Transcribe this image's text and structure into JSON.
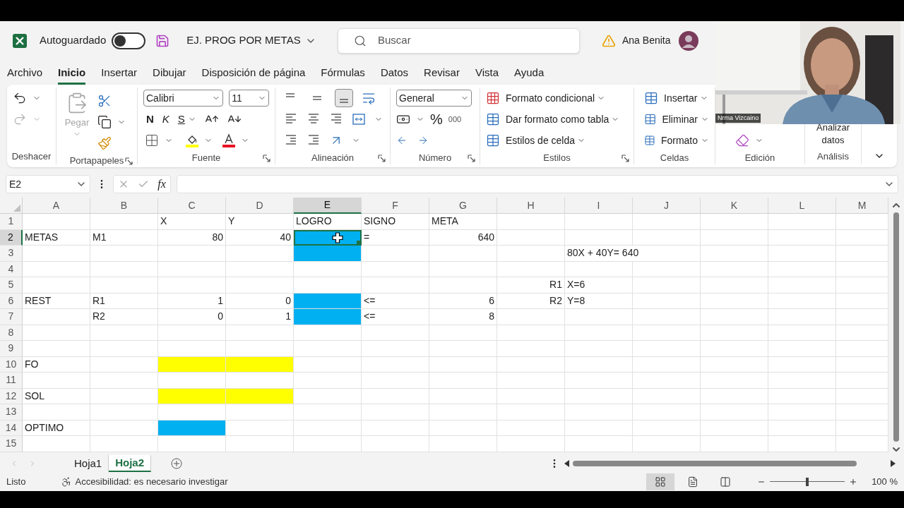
{
  "title_bar": {
    "autosave_label": "Autoguardado",
    "autosave_on": false,
    "document_title": "EJ. PROG POR METAS",
    "search_placeholder": "Buscar",
    "user_name": "Ana Benita"
  },
  "menu_tabs": [
    {
      "label": "Archivo",
      "selected": false
    },
    {
      "label": "Inicio",
      "selected": true
    },
    {
      "label": "Insertar",
      "selected": false
    },
    {
      "label": "Dibujar",
      "selected": false
    },
    {
      "label": "Disposición de página",
      "selected": false
    },
    {
      "label": "Fórmulas",
      "selected": false
    },
    {
      "label": "Datos",
      "selected": false
    },
    {
      "label": "Revisar",
      "selected": false
    },
    {
      "label": "Vista",
      "selected": false
    },
    {
      "label": "Ayuda",
      "selected": false
    }
  ],
  "ribbon": {
    "undo": {
      "label": "Deshacer"
    },
    "clipboard": {
      "label": "Portapapeles",
      "paste_label": "Pegar",
      "paste_disabled": true
    },
    "font": {
      "label": "Fuente",
      "font_name": "Calibri",
      "font_size": "11",
      "bold": "N",
      "italic": "K",
      "underline": "S"
    },
    "alignment": {
      "label": "Alineación",
      "vertical_align": [
        {
          "kind": "top",
          "selected": false
        },
        {
          "kind": "middle",
          "selected": false
        },
        {
          "kind": "bottom",
          "selected": true
        }
      ]
    },
    "number": {
      "label": "Número",
      "format": "General",
      "percent": "%",
      "thousands": "000"
    },
    "styles": {
      "label": "Estilos",
      "items": [
        "Formato condicional",
        "Dar formato como tabla",
        "Estilos de celda"
      ]
    },
    "cells": {
      "label": "Celdas",
      "items": [
        "Insertar",
        "Eliminar",
        "Formato"
      ]
    },
    "editing": {
      "label": "Edición"
    },
    "analysis": {
      "label": "Análisis",
      "button": "Analizar datos"
    }
  },
  "formula_bar": {
    "name_box": "E2",
    "function_label": "fx"
  },
  "sheet": {
    "columns": [
      {
        "label": "A",
        "selected": false
      },
      {
        "label": "B",
        "selected": false
      },
      {
        "label": "C",
        "selected": false
      },
      {
        "label": "D",
        "selected": false
      },
      {
        "label": "E",
        "selected": true
      },
      {
        "label": "F",
        "selected": false
      },
      {
        "label": "G",
        "selected": false
      },
      {
        "label": "H",
        "selected": false
      },
      {
        "label": "I",
        "selected": false
      },
      {
        "label": "J",
        "selected": false
      },
      {
        "label": "K",
        "selected": false
      },
      {
        "label": "L",
        "selected": false
      },
      {
        "label": "M",
        "selected": false
      }
    ],
    "rows": [
      {
        "label": "1",
        "selected": false,
        "cells": [
          {},
          {},
          {
            "text": "X",
            "kind": "text"
          },
          {
            "text": "Y",
            "kind": "text"
          },
          {
            "text": "LOGRO",
            "kind": "text"
          },
          {
            "text": "SIGNO",
            "kind": "text"
          },
          {
            "text": "META",
            "kind": "text"
          },
          {},
          {},
          {},
          {},
          {},
          {}
        ]
      },
      {
        "label": "2",
        "selected": true,
        "cells": [
          {
            "text": "METAS",
            "kind": "text"
          },
          {
            "text": "M1",
            "kind": "text"
          },
          {
            "text": "80",
            "kind": "number"
          },
          {
            "text": "40",
            "kind": "number"
          },
          {
            "color": "#00b0f0"
          },
          {
            "text": "=",
            "kind": "text"
          },
          {
            "text": "640",
            "kind": "number"
          },
          {},
          {},
          {},
          {},
          {},
          {}
        ]
      },
      {
        "label": "3",
        "selected": false,
        "cells": [
          {},
          {},
          {},
          {},
          {
            "color": "#00b0f0"
          },
          {},
          {},
          {},
          {
            "text": "80X + 40Y= 640",
            "kind": "text"
          },
          {},
          {},
          {},
          {}
        ]
      },
      {
        "label": "4",
        "selected": false,
        "cells": [
          {},
          {},
          {},
          {},
          {},
          {},
          {},
          {},
          {},
          {},
          {},
          {},
          {}
        ]
      },
      {
        "label": "5",
        "selected": false,
        "cells": [
          {},
          {},
          {},
          {},
          {},
          {},
          {},
          {
            "text": "R1",
            "kind": "number"
          },
          {
            "text": "X=6",
            "kind": "text"
          },
          {},
          {},
          {},
          {}
        ]
      },
      {
        "label": "6",
        "selected": false,
        "cells": [
          {
            "text": "REST",
            "kind": "text"
          },
          {
            "text": "R1",
            "kind": "text"
          },
          {
            "text": "1",
            "kind": "number"
          },
          {
            "text": "0",
            "kind": "number"
          },
          {
            "color": "#00b0f0"
          },
          {
            "text": "<=",
            "kind": "text"
          },
          {
            "text": "6",
            "kind": "number"
          },
          {
            "text": "R2",
            "kind": "number"
          },
          {
            "text": "Y=8",
            "kind": "text"
          },
          {},
          {},
          {},
          {}
        ]
      },
      {
        "label": "7",
        "selected": false,
        "cells": [
          {},
          {
            "text": "R2",
            "kind": "text"
          },
          {
            "text": "0",
            "kind": "number"
          },
          {
            "text": "1",
            "kind": "number"
          },
          {
            "color": "#00b0f0"
          },
          {
            "text": "<=",
            "kind": "text"
          },
          {
            "text": "8",
            "kind": "number"
          },
          {},
          {},
          {},
          {},
          {},
          {}
        ]
      },
      {
        "label": "8",
        "selected": false,
        "cells": [
          {},
          {},
          {},
          {},
          {},
          {},
          {},
          {},
          {},
          {},
          {},
          {},
          {}
        ]
      },
      {
        "label": "9",
        "selected": false,
        "cells": [
          {},
          {},
          {},
          {},
          {},
          {},
          {},
          {},
          {},
          {},
          {},
          {},
          {}
        ]
      },
      {
        "label": "10",
        "selected": false,
        "cells": [
          {
            "text": "FO",
            "kind": "text"
          },
          {},
          {
            "color": "#ffff00"
          },
          {
            "color": "#ffff00"
          },
          {},
          {},
          {},
          {},
          {},
          {},
          {},
          {},
          {}
        ]
      },
      {
        "label": "11",
        "selected": false,
        "cells": [
          {},
          {},
          {},
          {},
          {},
          {},
          {},
          {},
          {},
          {},
          {},
          {},
          {}
        ]
      },
      {
        "label": "12",
        "selected": false,
        "cells": [
          {
            "text": "SOL",
            "kind": "text"
          },
          {},
          {
            "color": "#ffff00"
          },
          {
            "color": "#ffff00"
          },
          {},
          {},
          {},
          {},
          {},
          {},
          {},
          {},
          {}
        ]
      },
      {
        "label": "13",
        "selected": false,
        "cells": [
          {},
          {},
          {},
          {},
          {},
          {},
          {},
          {},
          {},
          {},
          {},
          {},
          {}
        ]
      },
      {
        "label": "14",
        "selected": false,
        "cells": [
          {
            "text": "OPTIMO",
            "kind": "text"
          },
          {},
          {
            "color": "#00b0f0"
          },
          {},
          {},
          {},
          {},
          {},
          {},
          {},
          {},
          {},
          {}
        ]
      },
      {
        "label": "15",
        "selected": false,
        "cells": [
          {},
          {},
          {},
          {},
          {},
          {},
          {},
          {},
          {},
          {},
          {},
          {},
          {}
        ]
      }
    ]
  },
  "sheet_tabs": [
    {
      "label": "Hoja1",
      "selected": false
    },
    {
      "label": "Hoja2",
      "selected": true
    }
  ],
  "status_bar": {
    "status": "Listo",
    "accessibility": "Accesibilidad: es necesario investigar",
    "views": [
      {
        "kind": "normal",
        "selected": true
      },
      {
        "kind": "page_layout",
        "selected": false
      },
      {
        "kind": "page_break",
        "selected": false
      }
    ],
    "level": 0.5,
    "zoom": "100 %"
  },
  "video": {
    "caption": "Nrma Vizcaino"
  }
}
